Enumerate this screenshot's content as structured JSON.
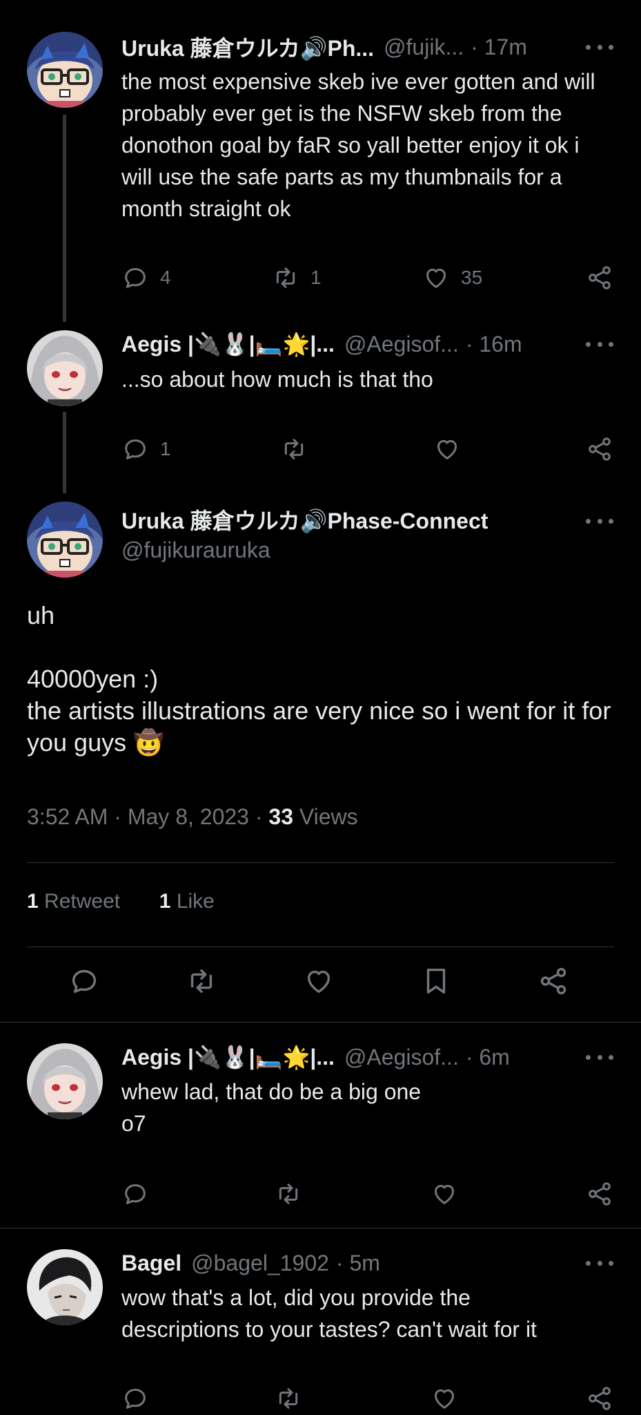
{
  "tweets": [
    {
      "name": "Uruka 藤倉ウルカ🔊Ph...",
      "handle": "@fujik...",
      "time": "· 17m",
      "text": "the most expensive skeb ive ever gotten and will probably ever get is the NSFW skeb from the donothon goal by faR so yall better enjoy it ok i will use the safe parts as my thumbnails for a month straight ok",
      "replies": "4",
      "retweets": "1",
      "likes": "35"
    },
    {
      "name": "Aegis |🔌🐰|🛏️🌟|...",
      "handle": "@Aegisof...",
      "time": "· 16m",
      "text": "...so about how much is that tho",
      "replies": "1",
      "retweets": "",
      "likes": ""
    }
  ],
  "main": {
    "name": "Uruka 藤倉ウルカ🔊Phase-Connect",
    "handle": "@fujikurauruka",
    "line1": "uh",
    "line2": "40000yen :)",
    "line3": "the artists illustrations are very nice so i went for it for you guys 🤠",
    "timestamp": "3:52 AM · May 8, 2023 ·",
    "views_count": "33",
    "views_label": "Views",
    "retweet_count": "1",
    "retweet_label": "Retweet",
    "like_count": "1",
    "like_label": "Like"
  },
  "replies": [
    {
      "name": "Aegis |🔌🐰|🛏️🌟|...",
      "handle": "@Aegisof...",
      "time": "· 6m",
      "line1": "whew lad, that do be a big one",
      "line2": "o7"
    },
    {
      "name": "Bagel",
      "handle": "@bagel_1902",
      "time": "· 5m",
      "line1": "wow that's a lot, did you provide the",
      "line2": "descriptions to your tastes? can't wait for it"
    }
  ],
  "colors": {
    "bg": "#000000",
    "text": "#e7e9ea",
    "muted": "#71767b",
    "divider": "#2f3336"
  },
  "icons": [
    "reply-icon",
    "retweet-icon",
    "like-icon",
    "bookmark-icon",
    "share-icon",
    "more-icon"
  ]
}
